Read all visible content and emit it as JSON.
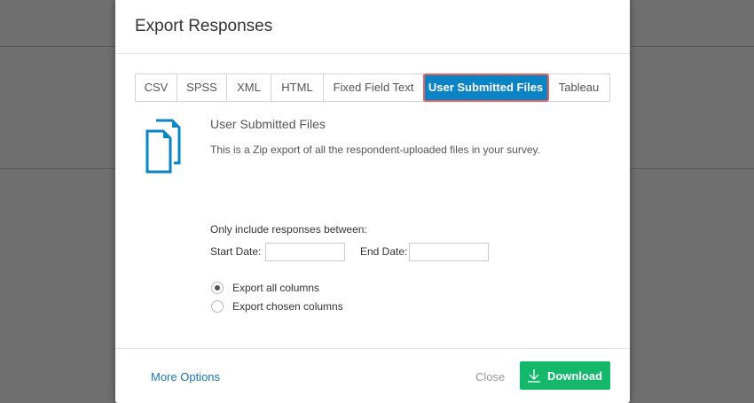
{
  "dialog": {
    "title": "Export Responses"
  },
  "tabs": [
    {
      "label": "CSV"
    },
    {
      "label": "SPSS"
    },
    {
      "label": "XML"
    },
    {
      "label": "HTML"
    },
    {
      "label": "Fixed Field Text"
    },
    {
      "label": "User Submitted Files"
    },
    {
      "label": "Tableau"
    }
  ],
  "content": {
    "title": "User Submitted Files",
    "description": "This is a Zip export of all the respondent-uploaded files in your survey.",
    "range_label": "Only include responses between:",
    "start_date_label": "Start Date:",
    "start_date_value": "",
    "end_date_label": "End Date:",
    "end_date_value": "",
    "radios": [
      {
        "label": "Export all columns",
        "checked": true
      },
      {
        "label": "Export chosen columns",
        "checked": false
      }
    ]
  },
  "footer": {
    "more_options": "More Options",
    "close": "Close",
    "download": "Download"
  },
  "colors": {
    "accent": "#0b84c6",
    "download": "#14b86b",
    "highlight": "#e8605a"
  }
}
